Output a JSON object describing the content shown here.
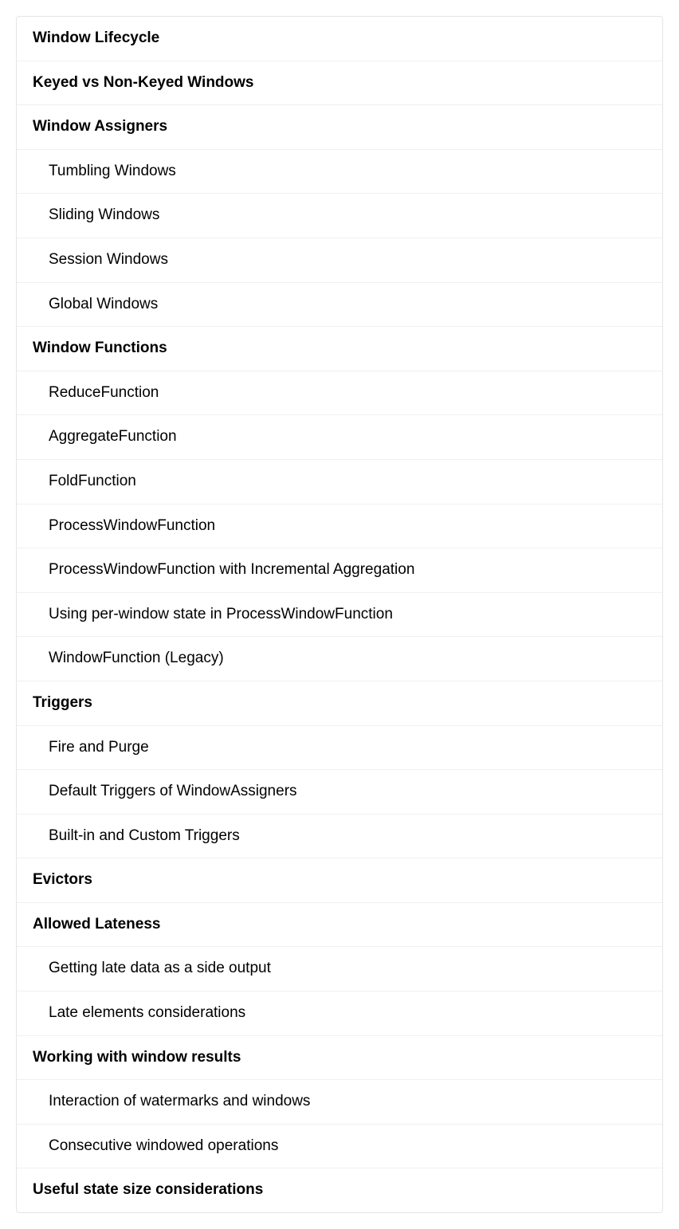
{
  "toc": [
    {
      "label": "Window Lifecycle",
      "level": "section"
    },
    {
      "label": "Keyed vs Non-Keyed Windows",
      "level": "section"
    },
    {
      "label": "Window Assigners",
      "level": "section"
    },
    {
      "label": "Tumbling Windows",
      "level": "subsection"
    },
    {
      "label": "Sliding Windows",
      "level": "subsection"
    },
    {
      "label": "Session Windows",
      "level": "subsection"
    },
    {
      "label": "Global Windows",
      "level": "subsection"
    },
    {
      "label": "Window Functions",
      "level": "section"
    },
    {
      "label": "ReduceFunction",
      "level": "subsection"
    },
    {
      "label": "AggregateFunction",
      "level": "subsection"
    },
    {
      "label": "FoldFunction",
      "level": "subsection"
    },
    {
      "label": "ProcessWindowFunction",
      "level": "subsection"
    },
    {
      "label": "ProcessWindowFunction with Incremental Aggregation",
      "level": "subsection"
    },
    {
      "label": "Using per-window state in ProcessWindowFunction",
      "level": "subsection"
    },
    {
      "label": "WindowFunction (Legacy)",
      "level": "subsection"
    },
    {
      "label": "Triggers",
      "level": "section"
    },
    {
      "label": "Fire and Purge",
      "level": "subsection"
    },
    {
      "label": "Default Triggers of WindowAssigners",
      "level": "subsection"
    },
    {
      "label": "Built-in and Custom Triggers",
      "level": "subsection"
    },
    {
      "label": "Evictors",
      "level": "section"
    },
    {
      "label": "Allowed Lateness",
      "level": "section"
    },
    {
      "label": "Getting late data as a side output",
      "level": "subsection"
    },
    {
      "label": "Late elements considerations",
      "level": "subsection"
    },
    {
      "label": "Working with window results",
      "level": "section"
    },
    {
      "label": "Interaction of watermarks and windows",
      "level": "subsection"
    },
    {
      "label": "Consecutive windowed operations",
      "level": "subsection"
    },
    {
      "label": "Useful state size considerations",
      "level": "section"
    }
  ]
}
